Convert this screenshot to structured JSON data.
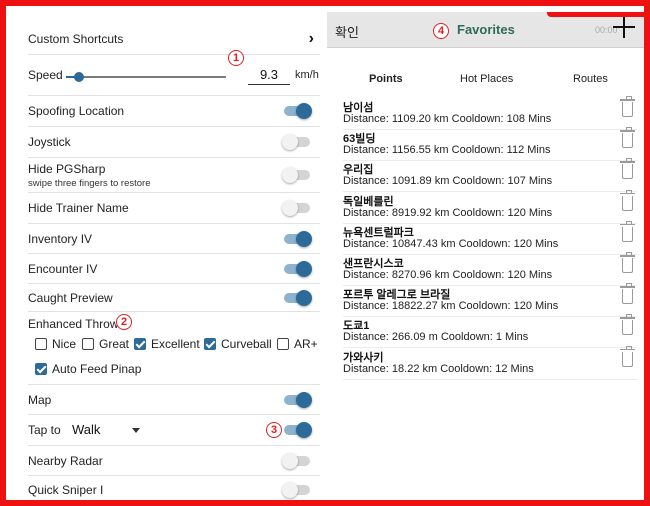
{
  "settings": {
    "custom_shortcuts": "Custom Shortcuts",
    "speed_label": "Speed",
    "speed_value": "9.3",
    "speed_unit": "km/h",
    "speed_fraction": 0.08,
    "spoofing_location": "Spoofing Location",
    "joystick": "Joystick",
    "hide_pgsharp": "Hide PGSharp",
    "hide_pgsharp_sub": "swipe three fingers to restore",
    "hide_trainer_name": "Hide Trainer Name",
    "inventory_iv": "Inventory IV",
    "encounter_iv": "Encounter IV",
    "caught_preview": "Caught Preview",
    "enhanced_throw": "Enhanced Throw",
    "throws": [
      {
        "label": "Nice",
        "checked": false
      },
      {
        "label": "Great",
        "checked": false
      },
      {
        "label": "Excellent",
        "checked": true
      },
      {
        "label": "Curveball",
        "checked": true
      },
      {
        "label": "AR+",
        "checked": false
      }
    ],
    "auto_feed_pinap": "Auto Feed Pinap",
    "map": "Map",
    "tap_to": "Tap to",
    "tap_to_value": "Walk",
    "nearby_radar": "Nearby Radar",
    "quick_sniper": "Quick Sniper I"
  },
  "annotations": [
    "1",
    "2",
    "3",
    "4"
  ],
  "favorites": {
    "confirm": "확인",
    "title": "Favorites",
    "time": "00:00",
    "tabs": [
      "Points",
      "Hot Places",
      "Routes"
    ],
    "items": [
      {
        "name": "남이섬",
        "detail": "Distance: 1109.20 km Cooldown: 108 Mins"
      },
      {
        "name": "63빌딩",
        "detail": "Distance: 1156.55 km Cooldown: 112 Mins"
      },
      {
        "name": "우리집",
        "detail": "Distance: 1091.89 km Cooldown: 107 Mins"
      },
      {
        "name": "독일베를린",
        "detail": "Distance: 8919.92 km Cooldown: 120 Mins"
      },
      {
        "name": "뉴욕센트럴파크",
        "detail": "Distance: 10847.43 km Cooldown: 120 Mins"
      },
      {
        "name": "샌프란시스코",
        "detail": "Distance: 8270.96 km Cooldown: 120 Mins"
      },
      {
        "name": "포르투 알레그로 브라질",
        "detail": "Distance: 18822.27 km Cooldown: 120 Mins"
      },
      {
        "name": "도쿄1",
        "detail": "Distance: 266.09 m Cooldown: 1 Mins"
      },
      {
        "name": "가와사키",
        "detail": "Distance: 18.22 km Cooldown: 12 Mins"
      }
    ]
  }
}
